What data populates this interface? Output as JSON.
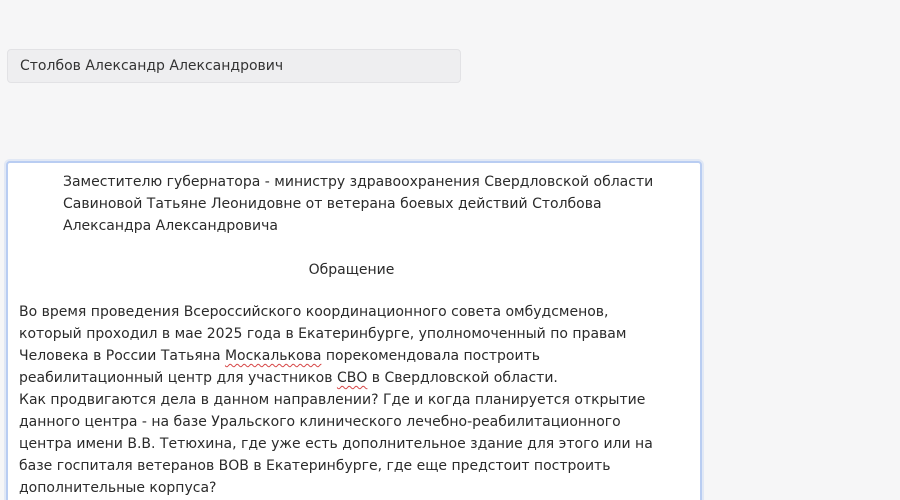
{
  "form": {
    "name_value": "Столбов Александр Александрович"
  },
  "letter": {
    "addressee": "Заместителю губернатора - министру здравоохранения Свердловской области\nСавиновой Татьяне Леонидовне от ветерана боевых действий Столбова\nАлександра Александровича",
    "title": "Обращение",
    "p1_a": "  Во время проведения Всероссийского координационного совета омбудсменов,\nкоторый проходил в мае 2025 года в Екатеринбурге, уполномоченный по правам\nЧеловека в России Татьяна ",
    "p1_spell1": "Москалькова",
    "p1_b": " порекомендовала построить\nреабилитационный центр для участников ",
    "p1_spell2": "СВО",
    "p1_c": " в Свердловской области.",
    "p2": "Как продвигаются дела в данном направлении? Где  и когда планируется открытие\nданного центра - на базе Уральского клинического лечебно-реабилитационного\nцентра имени В.В. Тетюхина, где уже есть дополнительное здание для этого  или на\nбазе госпиталя ветеранов ВОВ в Екатеринбурге, где еще предстоит построить\nдополнительные корпуса?"
  }
}
